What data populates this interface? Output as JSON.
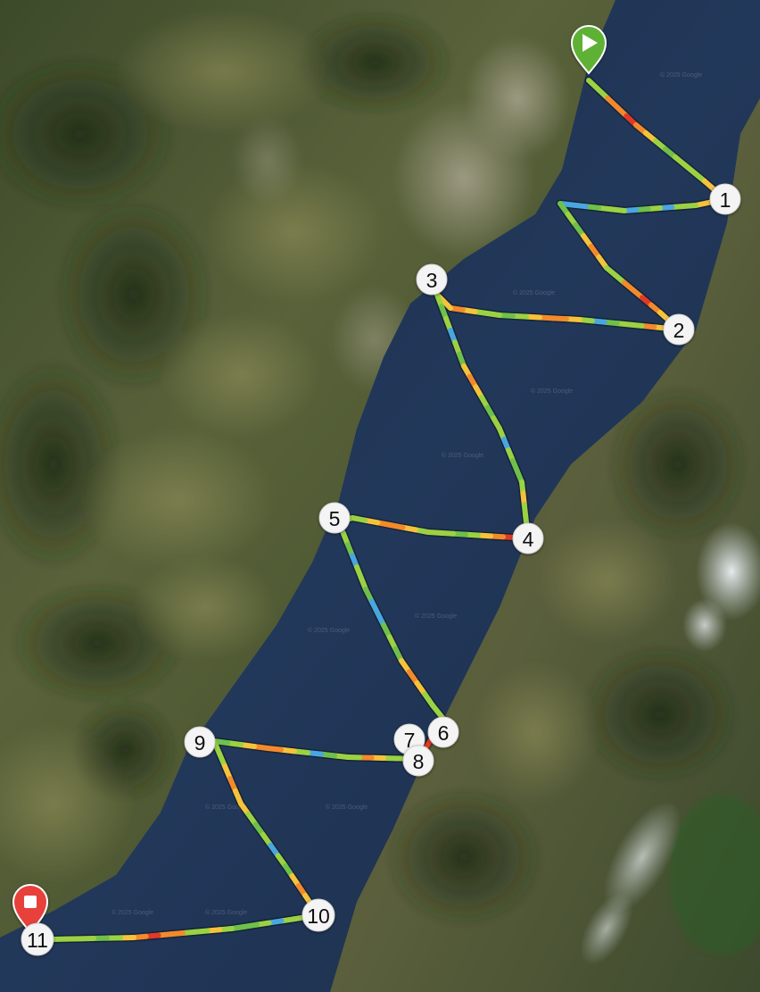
{
  "map": {
    "type": "satellite",
    "attribution": "© 2025 Google",
    "route_colors": [
      "#e03a26",
      "#f28a2c",
      "#f5c33b",
      "#9bd243",
      "#6ec04a",
      "#4aa6df"
    ]
  },
  "start_marker": {
    "icon": "play-icon",
    "color": "#5fb136"
  },
  "end_marker": {
    "icon": "stop-icon",
    "color": "#e8403a"
  },
  "waypoints": [
    {
      "label": "1"
    },
    {
      "label": "2"
    },
    {
      "label": "3"
    },
    {
      "label": "4"
    },
    {
      "label": "5"
    },
    {
      "label": "6"
    },
    {
      "label": "7"
    },
    {
      "label": "8"
    },
    {
      "label": "9"
    },
    {
      "label": "10"
    },
    {
      "label": "11"
    }
  ]
}
